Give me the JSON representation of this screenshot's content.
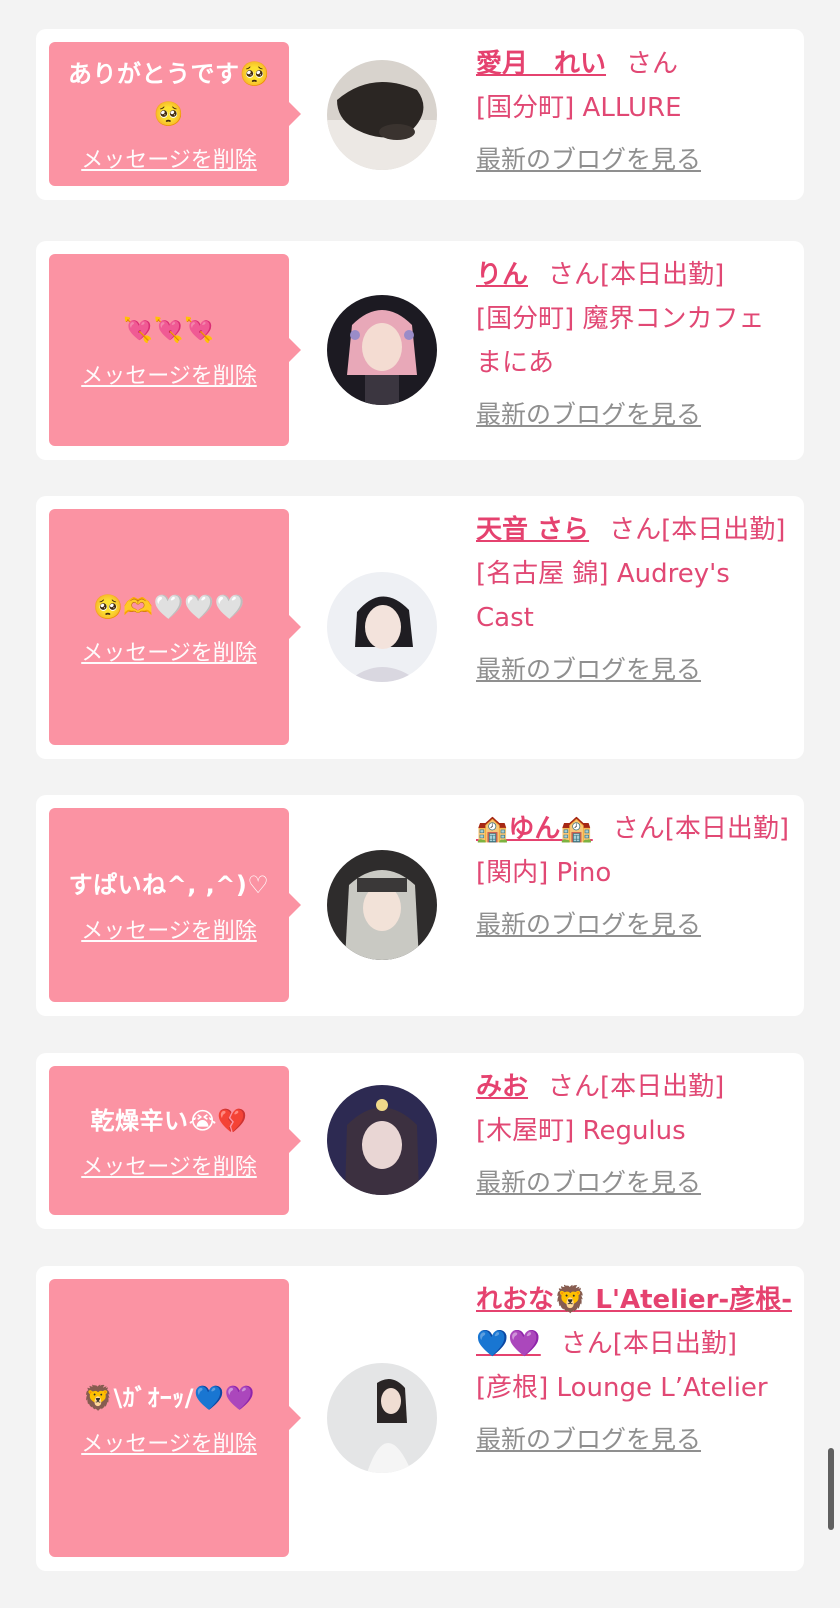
{
  "delete_label": "メッセージを削除",
  "blog_label": "最新のブログを見る",
  "san_label": "さん",
  "cards": [
    {
      "message": "ありがとうです🥺🥺",
      "name": "愛月　れい",
      "suffix": "さん",
      "shop": "[国分町] ALLURE"
    },
    {
      "message": "💘💘💘",
      "name": "りん",
      "suffix": "さん[本日出勤]",
      "shop": "[国分町] 魔界コンカフェ まにあ"
    },
    {
      "message": "🥺🫶🤍🤍🤍",
      "name": "天音 さら",
      "suffix": "さん[本日出勤]",
      "shop": "[名古屋 錦] Audrey's Cast"
    },
    {
      "message": "すぱいね^, ,^)♡",
      "name": "🏫ゆん🏫",
      "suffix": "さん[本日出勤]",
      "shop": "[関内] Pino"
    },
    {
      "message": "乾燥辛い😭💔",
      "name": "みお",
      "suffix": "さん[本日出勤]",
      "shop": "[木屋町] Regulus"
    },
    {
      "message": "🦁\\ｶﾞｵｰｯ/💙💜",
      "name": "れおな🦁 L'Atelier-彦根-💙💜",
      "suffix": "さん[本日出勤]",
      "shop": "[彦根] Lounge L’Atelier"
    }
  ],
  "colors": {
    "bubble": "#fb93a3",
    "accent": "#e5426f",
    "link_gray": "#8f8f8f",
    "background": "#f3f3f3"
  }
}
